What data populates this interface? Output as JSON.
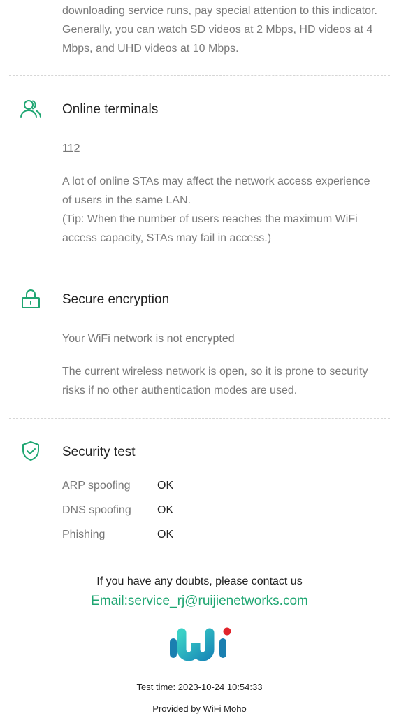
{
  "colors": {
    "accent": "#1fa672",
    "grey_text": "#7a7a7a",
    "divider": "#d6d6d6"
  },
  "bandwidth": {
    "lines": [
      "downloading service runs, pay special attention to this indicator.",
      "Generally, you can watch SD videos at 2 Mbps, HD videos at 4",
      "Mbps, and UHD videos at 10 Mbps."
    ]
  },
  "terminals": {
    "icon": "users-icon",
    "title": "Online terminals",
    "count": "112",
    "lines": [
      "A lot of online STAs may affect the network access experience",
      "of users in the same LAN.",
      "(Tip: When the number of users reaches the maximum WiFi",
      "access capacity, STAs may fail in access.)"
    ]
  },
  "encryption": {
    "icon": "lock-icon",
    "title": "Secure encryption",
    "status": "Your WiFi network is not encrypted",
    "lines": [
      "The current wireless network is open, so it is prone to security",
      "risks if no other authentication modes are used."
    ]
  },
  "security": {
    "icon": "shield-check-icon",
    "title": "Security test",
    "rows": [
      {
        "label": "ARP spoofing",
        "value": "OK"
      },
      {
        "label": "DNS spoofing",
        "value": "OK"
      },
      {
        "label": "Phishing",
        "value": "OK"
      }
    ]
  },
  "footer": {
    "contact_text": "If you have any doubts, please contact us",
    "email": "Email:service_rj@ruijienetworks.com",
    "logo": "wifi-moho-logo",
    "test_time": "Test time: 2023-10-24 10:54:33",
    "provided_by": "Provided by WiFi Moho"
  }
}
